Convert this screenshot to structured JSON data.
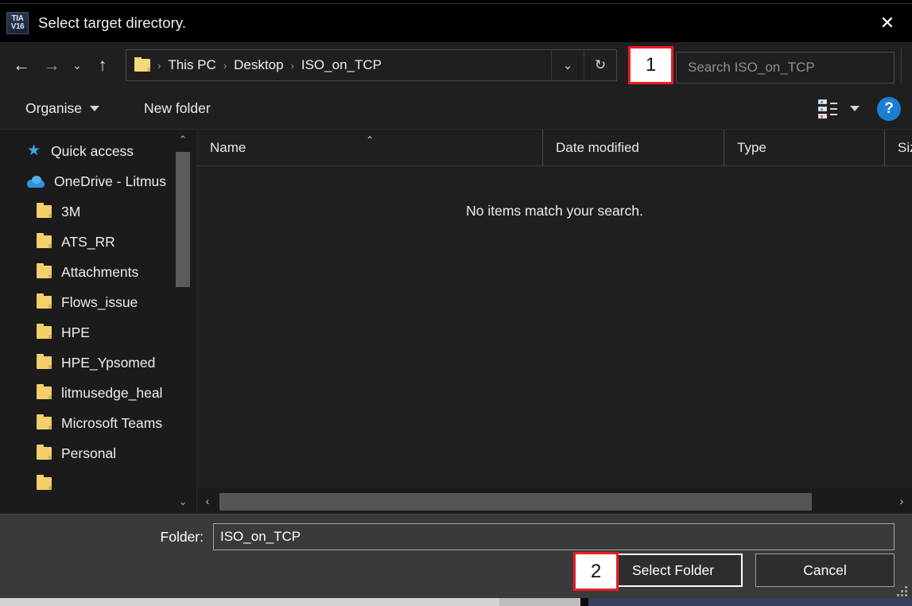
{
  "window": {
    "title": "Select target directory.",
    "app_icon_line1": "TIA",
    "app_icon_line2": "V16",
    "close_icon": "close-icon",
    "close_glyph": "✕"
  },
  "navbar": {
    "back_glyph": "←",
    "forward_glyph": "→",
    "recent_glyph": "⌄",
    "up_glyph": "↑",
    "breadcrumb": [
      {
        "label": "This PC"
      },
      {
        "label": "Desktop"
      },
      {
        "label": "ISO_on_TCP"
      }
    ],
    "separator": "›",
    "dropdown_glyph": "⌄",
    "refresh_glyph": "↻"
  },
  "search": {
    "placeholder": "Search ISO_on_TCP",
    "value": ""
  },
  "commandbar": {
    "organise_label": "Organise",
    "new_folder_label": "New folder",
    "view_dropdown_glyph": "▼",
    "help_label": "?"
  },
  "sidebar": {
    "items": [
      {
        "label": "Quick access",
        "icon": "star-icon",
        "level": 0
      },
      {
        "label": "OneDrive - Litmus",
        "icon": "cloud-icon",
        "level": 0
      },
      {
        "label": "3M",
        "icon": "folder-icon",
        "level": 1
      },
      {
        "label": "ATS_RR",
        "icon": "folder-icon",
        "level": 1
      },
      {
        "label": "Attachments",
        "icon": "folder-icon",
        "level": 1
      },
      {
        "label": "Flows_issue",
        "icon": "folder-icon",
        "level": 1
      },
      {
        "label": "HPE",
        "icon": "folder-icon",
        "level": 1
      },
      {
        "label": "HPE_Ypsomed",
        "icon": "folder-icon",
        "level": 1
      },
      {
        "label": "litmusedge_heal",
        "icon": "folder-icon",
        "level": 1
      },
      {
        "label": "Microsoft Teams",
        "icon": "folder-icon",
        "level": 1
      },
      {
        "label": "Personal",
        "icon": "folder-icon",
        "level": 1
      }
    ],
    "scroll_up_glyph": "⌃",
    "scroll_down_glyph": "⌄",
    "star_glyph": "★"
  },
  "filelist": {
    "columns": [
      {
        "label": "Name"
      },
      {
        "label": "Date modified"
      },
      {
        "label": "Type"
      },
      {
        "label": "Siz"
      }
    ],
    "sort_caret": "⌃",
    "empty_message": "No items match your search.",
    "rows": [],
    "hscroll_left_glyph": "‹",
    "hscroll_right_glyph": "›"
  },
  "footer": {
    "folder_label": "Folder:",
    "folder_value": "ISO_on_TCP",
    "select_folder_label": "Select Folder",
    "cancel_label": "Cancel"
  },
  "annotations": [
    {
      "id": 1,
      "text": "1"
    },
    {
      "id": 2,
      "text": "2"
    }
  ],
  "colors": {
    "accent_red": "#ee1c25",
    "help_blue": "#1a7fd4",
    "folder_yellow": "#f5d06a",
    "dialog_bg": "#1f1f1f",
    "titlebar_bg": "#000000",
    "footer_bg": "#3a3a3a"
  }
}
